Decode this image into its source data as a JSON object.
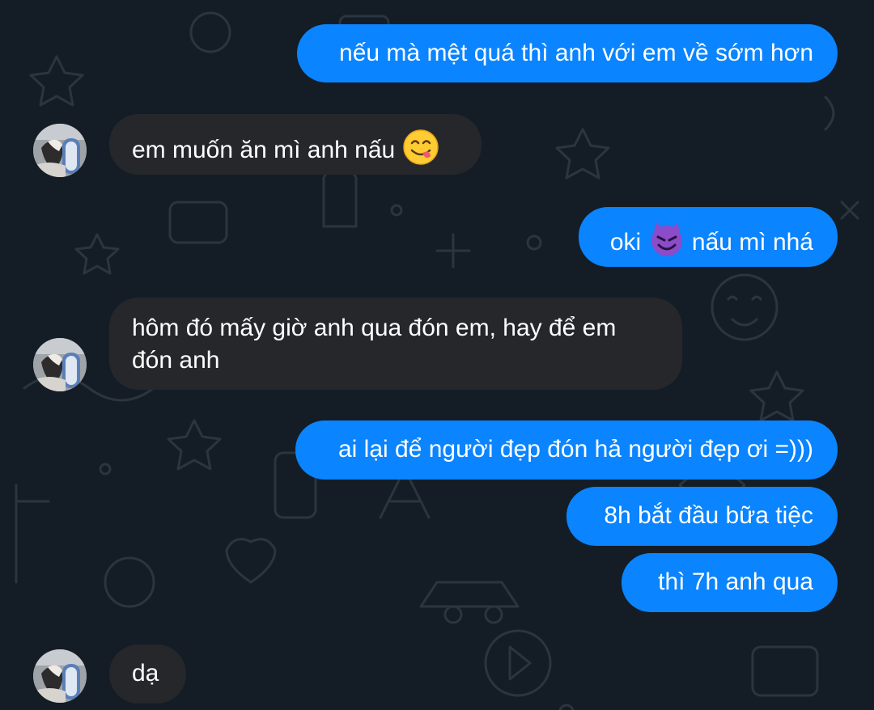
{
  "messages": [
    {
      "direction": "outgoing",
      "text": "nếu mà mệt quá thì anh với em về sớm hơn"
    },
    {
      "direction": "incoming",
      "text": "em muốn ăn mì anh nấu",
      "emoji": "face-savoring-food-emoji"
    },
    {
      "direction": "outgoing",
      "text_before": "oki",
      "emoji": "smiling-devil-emoji",
      "text_after": "nấu mì nhá"
    },
    {
      "direction": "incoming",
      "line1": "hôm đó mấy giờ anh qua đón em, hay để em",
      "line2": "đón anh"
    },
    {
      "direction": "outgoing",
      "text": "ai lại để người đẹp đón hả người đẹp ơi =)))"
    },
    {
      "direction": "outgoing",
      "text": "8h bắt đầu bữa tiệc"
    },
    {
      "direction": "outgoing",
      "text": "thì 7h anh qua"
    },
    {
      "direction": "incoming",
      "text": "dạ"
    }
  ],
  "colors": {
    "background": "#141d25",
    "outgoing_bubble": "#0a84ff",
    "incoming_bubble": "#25272b",
    "text": "#ffffff"
  }
}
